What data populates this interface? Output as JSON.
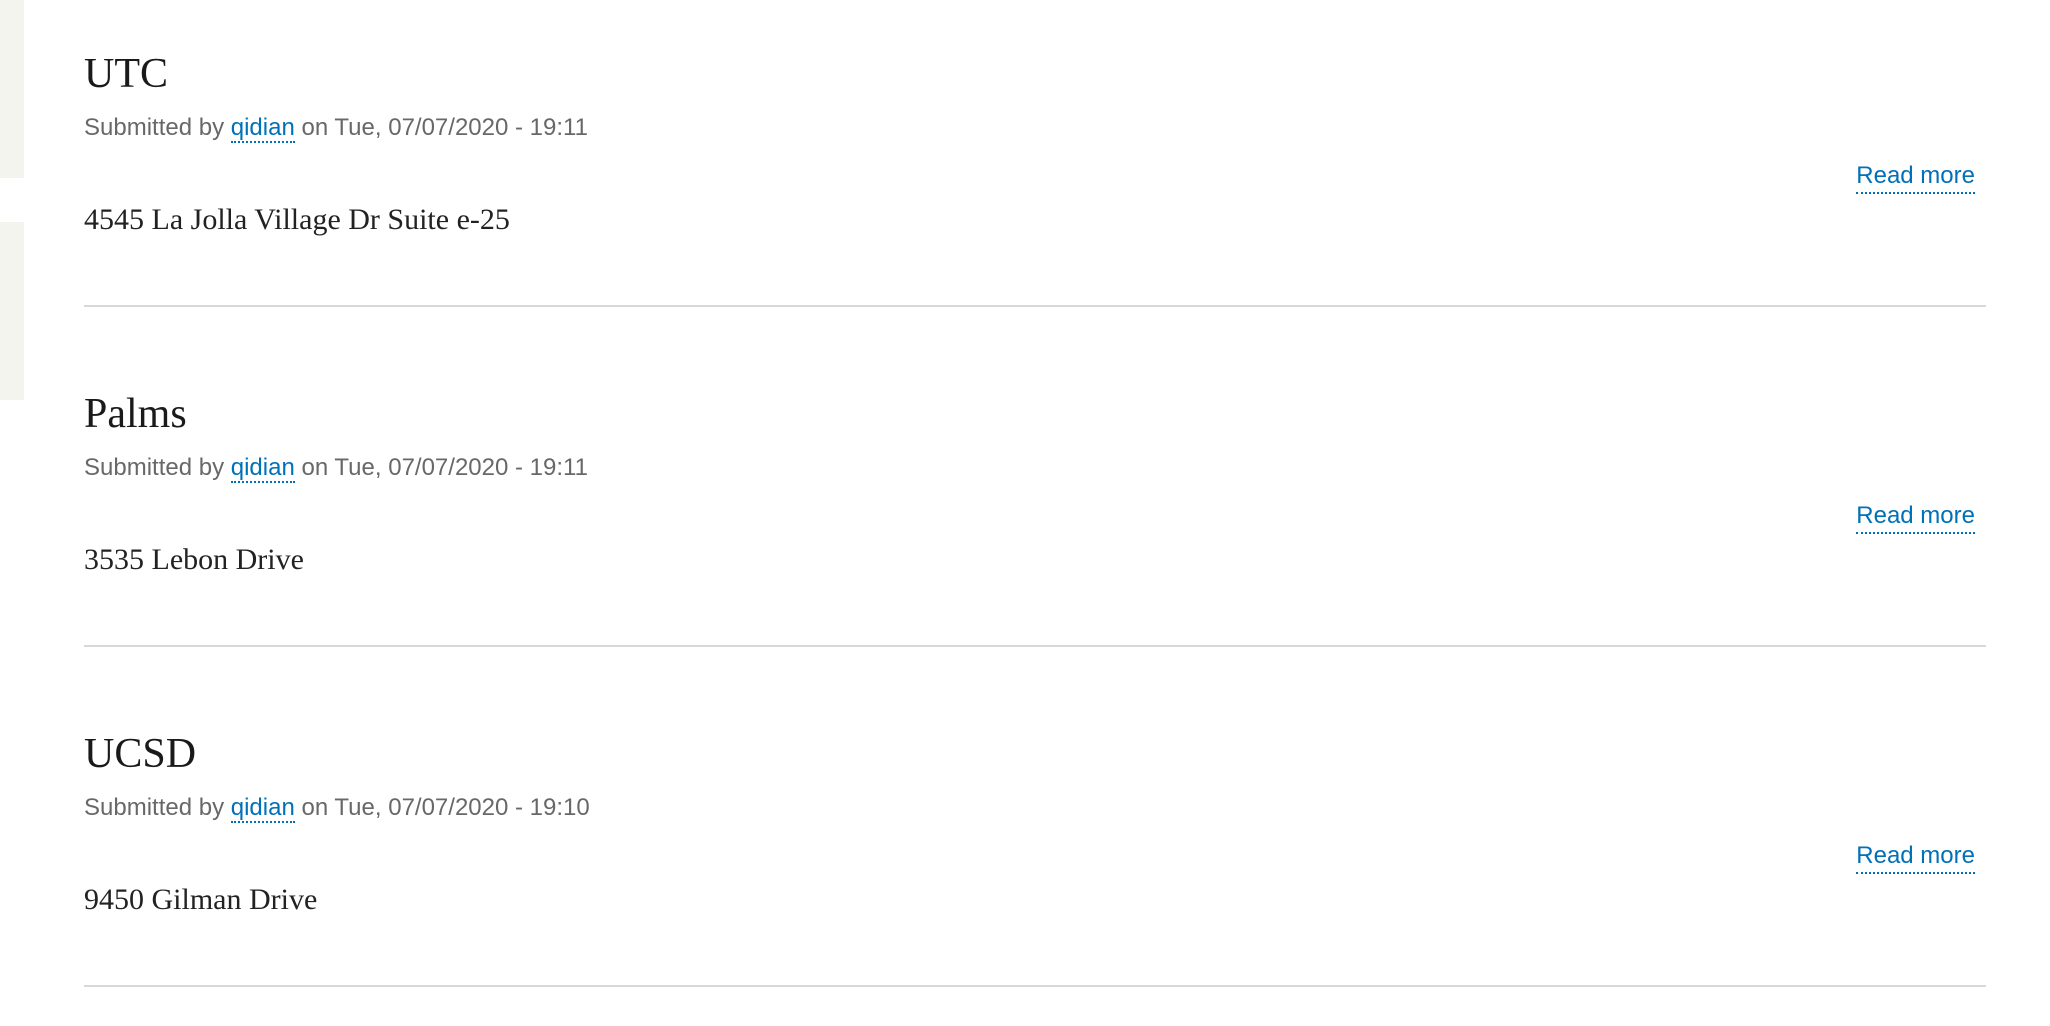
{
  "nodes": [
    {
      "title": "UTC",
      "submitted_prefix": "Submitted by",
      "author": "qidian",
      "date_text": "on Tue, 07/07/2020 - 19:11",
      "read_more": "Read more",
      "address": "4545 La Jolla Village Dr Suite e-25"
    },
    {
      "title": "Palms",
      "submitted_prefix": "Submitted by",
      "author": "qidian",
      "date_text": "on Tue, 07/07/2020 - 19:11",
      "read_more": "Read more",
      "address": "3535 Lebon Drive"
    },
    {
      "title": "UCSD",
      "submitted_prefix": "Submitted by",
      "author": "qidian",
      "date_text": "on Tue, 07/07/2020 - 19:10",
      "read_more": "Read more",
      "address": "9450 Gilman Drive"
    }
  ],
  "colors": {
    "link": "#0071b8",
    "meta_text": "#686868",
    "divider": "#d8d8d8",
    "sidebar_bg": "#f4f4ef"
  }
}
